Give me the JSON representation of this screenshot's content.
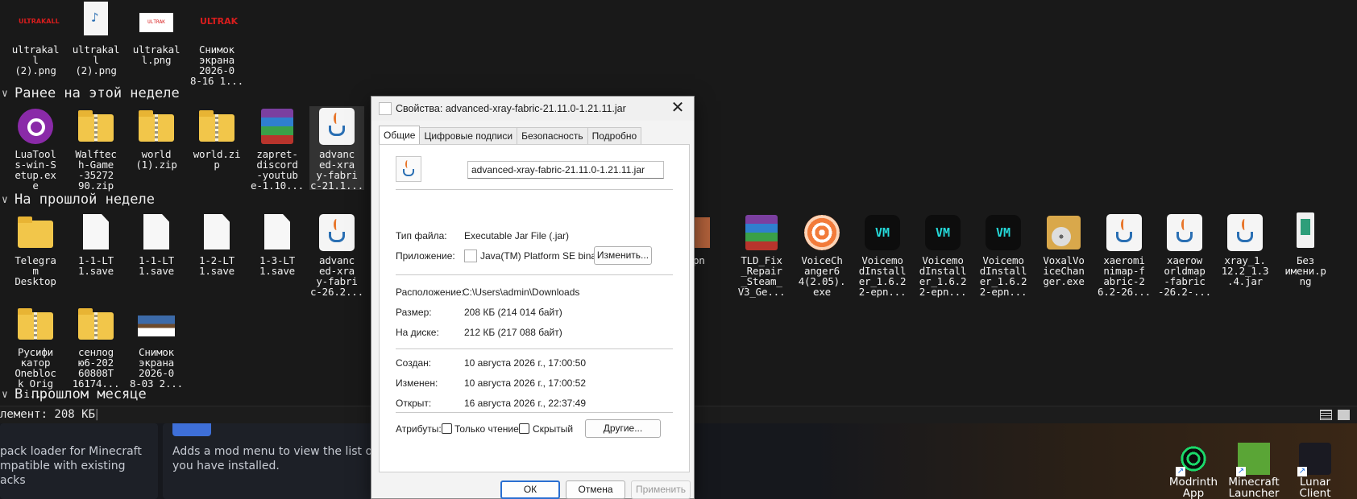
{
  "explorer": {
    "groups": [
      {
        "label": "Ранее на этой неделе"
      },
      {
        "label": "На прошлой неделе"
      },
      {
        "label": "В прошлом месяце"
      }
    ],
    "recent_files": [
      {
        "label": "ultrakal\nl\n(2).png",
        "thumb": "ULTRAKALL"
      },
      {
        "label": "ultrakal\nl\n(2).png"
      },
      {
        "label": "ultrakal\nl.png",
        "thumb": "ULTRAK"
      },
      {
        "label": "Снимок\nэкрана\n2026-0\n8-16 1...",
        "thumb": "ULTRAK"
      }
    ],
    "this_week": [
      {
        "label": "LuaTool\ns-win-S\netup.ex\ne"
      },
      {
        "label": "Walftec\nh-Game\n-35272\n90.zip"
      },
      {
        "label": "world\n(1).zip"
      },
      {
        "label": "world.zi\np"
      },
      {
        "label": "zapret-\ndiscord\n-youtub\ne-1.10..."
      },
      {
        "label": "advanc\ned-xra\ny-fabri\nc-21.1..."
      }
    ],
    "last_week": [
      {
        "label": "Telegra\nm\nDesktop"
      },
      {
        "label": "1-1-LT\n1.save"
      },
      {
        "label": "1-1-LT\n1.save"
      },
      {
        "label": "1-2-LT\n1.save"
      },
      {
        "label": "1-3-LT\n1.save"
      },
      {
        "label": "advanc\ned-xra\ny-fabri\nc-26.2..."
      },
      {
        "label": "do.pn\ng"
      },
      {
        "label": "TLD_Fix\n_Repair\n_Steam_\nV3_Ge..."
      },
      {
        "label": "VoiceCh\nanger6\n4(2.05).\nexe"
      },
      {
        "label": "Voicemo\ndInstall\ner_1.6.2\n2-epn..."
      },
      {
        "label": "Voicemo\ndInstall\ner_1.6.2\n2-epn..."
      },
      {
        "label": "Voicemo\ndInstall\ner_1.6.2\n2-epn..."
      },
      {
        "label": "VoxalVo\niceChan\nger.exe"
      },
      {
        "label": "xaeromi\nnimap-f\nabric-2\n6.2-26..."
      },
      {
        "label": "xaerow\norldmap\n-fabric\n-26.2-..."
      },
      {
        "label": "xray_1.\n12.2_1.3\n.4.jar"
      },
      {
        "label": "Без\nимени.p\nng"
      }
    ],
    "row3": [
      {
        "label": "Русифи\nкатор\nOnebloc\nk Origi..."
      },
      {
        "label": "сенлоg\nю6-202\n60808T\n16174..."
      },
      {
        "label": "Снимок\nэкрана\n2026-0\n8-03 2..."
      }
    ],
    "status": "лемент: 208 КБ",
    "status_sep": "|"
  },
  "background_page": {
    "left_text": "pack loader for Minecraft\nmpatible with existing\nacks",
    "right_text": "Adds a mod menu to view the list of m\nyou have installed."
  },
  "desktop_icons": [
    {
      "label": "Modrinth\nApp"
    },
    {
      "label": "Minecraft\nLauncher"
    },
    {
      "label": "Lunar\nClient"
    }
  ],
  "dialog": {
    "title": "Свойства: advanced-xray-fabric-21.11.0-1.21.11.jar",
    "tabs": [
      "Общие",
      "Цифровые подписи",
      "Безопасность",
      "Подробно"
    ],
    "filename": "advanced-xray-fabric-21.11.0-1.21.11.jar",
    "file_type_label": "Тип файла:",
    "file_type": "Executable Jar File (.jar)",
    "app_label": "Приложение:",
    "app": "Java(TM) Platform SE binary",
    "change_button": "Изменить...",
    "location_label": "Расположение:",
    "location": "C:\\Users\\admin\\Downloads",
    "size_label": "Размер:",
    "size": "208 КБ (214 014 байт)",
    "disk_label": "На диске:",
    "disk": "212 КБ (217 088 байт)",
    "created_label": "Создан:",
    "created": "10 августа 2026 г., 17:00:50",
    "modified_label": "Изменен:",
    "modified": "10 августа 2026 г., 17:00:52",
    "opened_label": "Открыт:",
    "opened": "16 августа 2026 г., 22:37:49",
    "attributes_label": "Атрибуты:",
    "readonly_label": "Только чтение",
    "hidden_label": "Скрытый",
    "other_button": "Другие...",
    "ok_button": "ОК",
    "cancel_button": "Отмена",
    "apply_button": "Применить"
  },
  "colors": {
    "accent": "#2a6fd1",
    "explorer_bg": "#191919",
    "dialog_bg": "#f3f3f3"
  }
}
